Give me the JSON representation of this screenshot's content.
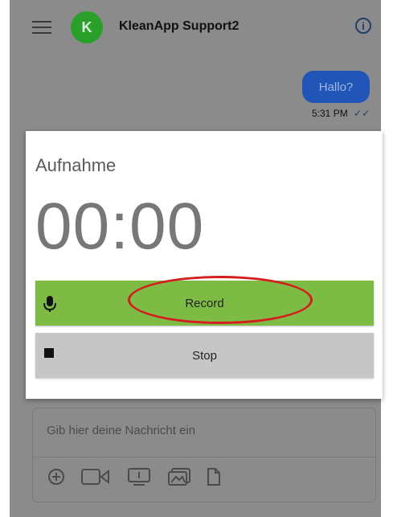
{
  "header": {
    "title": "KleanApp Support2",
    "avatar_letter": "K",
    "avatar_color": "#2aa02a"
  },
  "chat": {
    "messages": [
      {
        "text": "Hallo?",
        "time": "5:31 PM",
        "status_icon": "double-check-icon"
      }
    ]
  },
  "composer": {
    "placeholder": "Gib hier deine Nachricht ein",
    "tools": [
      "add-icon",
      "video-camera-icon",
      "screen-share-icon",
      "photo-icon",
      "file-icon"
    ]
  },
  "dialog": {
    "title": "Aufnahme",
    "timer": "00:00",
    "record_label": "Record",
    "stop_label": "Stop",
    "record_color": "#7dbb44",
    "stop_color": "#c6c6c6",
    "annotation_color": "#d41e1e"
  }
}
